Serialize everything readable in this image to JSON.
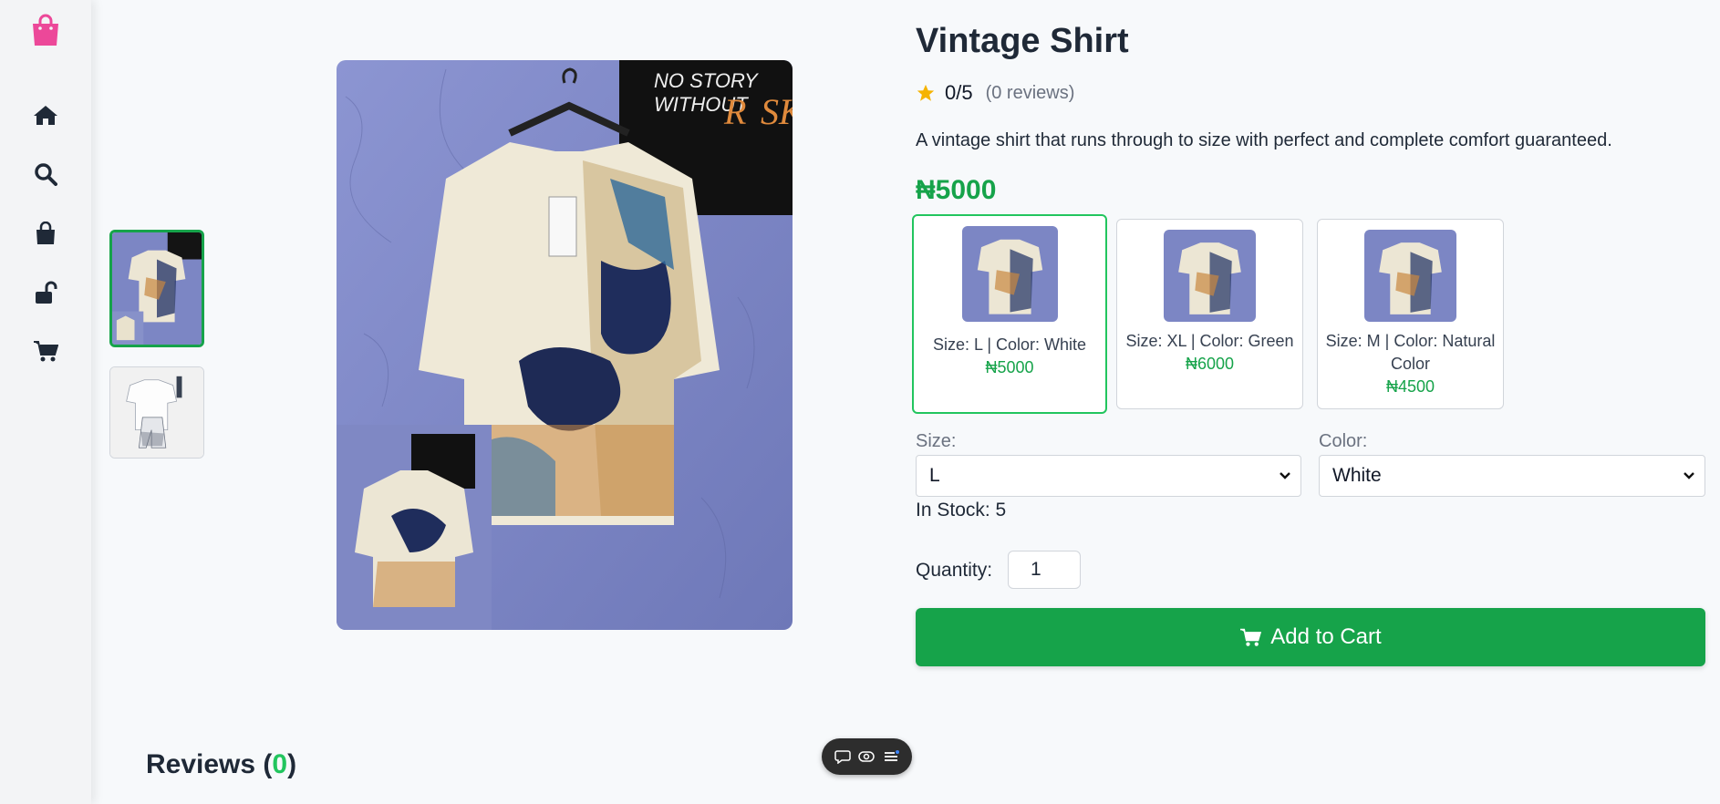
{
  "sidebar": {
    "items": [
      {
        "name": "logo",
        "icon": "shopping-bag-icon"
      },
      {
        "name": "home",
        "icon": "home-icon"
      },
      {
        "name": "search",
        "icon": "search-icon"
      },
      {
        "name": "bag",
        "icon": "shopping-bag-icon"
      },
      {
        "name": "unlock",
        "icon": "unlock-icon"
      },
      {
        "name": "cart",
        "icon": "cart-icon"
      }
    ],
    "accent": "#ec4899"
  },
  "product": {
    "title": "Vintage Shirt",
    "rating": "0/5",
    "review_count": "(0 reviews)",
    "description": "A vintage shirt that runs through to size with perfect and complete comfort guaranteed.",
    "price": "₦5000",
    "in_stock": "In Stock: 5"
  },
  "variants": [
    {
      "label": "Size: L | Color: White",
      "price": "₦5000",
      "selected": true
    },
    {
      "label": "Size: XL | Color: Green",
      "price": "₦6000",
      "selected": false
    },
    {
      "label": "Size: M | Color: Natural Color",
      "price": "₦4500",
      "selected": false
    }
  ],
  "options": {
    "size_label": "Size:",
    "size_value": "L",
    "color_label": "Color:",
    "color_value": "White"
  },
  "quantity": {
    "label": "Quantity:",
    "value": "1"
  },
  "cart_button": {
    "label": "Add to Cart"
  },
  "reviews": {
    "heading_prefix": "Reviews (",
    "count": "0",
    "heading_suffix": ")"
  },
  "colors": {
    "brand_green": "#16a34a",
    "brand_pink": "#ec4899"
  }
}
